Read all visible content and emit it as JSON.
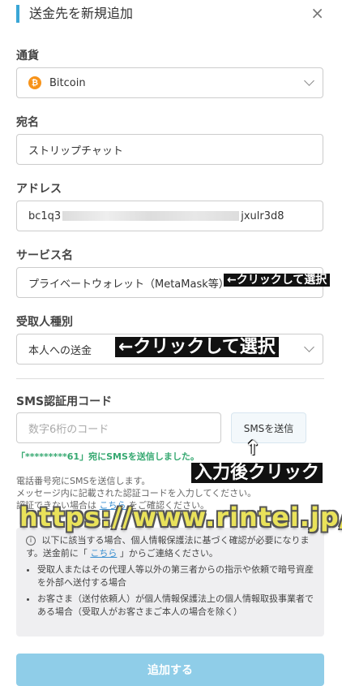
{
  "modal": {
    "title": "送金先を新規追加",
    "close": "×"
  },
  "currency": {
    "label": "通貨",
    "value": "Bitcoin",
    "icon_glyph": "₿"
  },
  "recipient": {
    "label": "宛名",
    "value": "ストリップチャット"
  },
  "address": {
    "label": "アドレス",
    "value_start": "bc1q3",
    "value_end": "jxulr3d8"
  },
  "service": {
    "label": "サービス名",
    "value": "プライベートウォレット（MetaMask等）"
  },
  "recipient_type": {
    "label": "受取人種別",
    "value": "本人への送金"
  },
  "sms": {
    "label": "SMS認証用コード",
    "placeholder": "数字6桁のコード",
    "button": "SMSを送信",
    "sent_message": "「*********61」宛にSMSを送信しました。",
    "info_line1": "電話番号宛にSMSを送信します。",
    "info_line2": "メッセージ内に記載された認証コードを入力してください。",
    "info_line3_pre": "認証できない場合は",
    "info_line3_link": "こちら",
    "info_line3_post": "をご確認ください。"
  },
  "notice": {
    "intro_pre": "以下に該当する場合、個人情報保護法に基づく確認が必要になります。送金前に「",
    "intro_link": "こちら",
    "intro_post": "」からご連絡ください。",
    "items": [
      "受取人またはその代理人等以外の第三者からの指示や依頼で暗号資産を外部へ送付する場合",
      "お客さま（送付依頼人）が個人情報保護法上の個人情報取扱事業者である場合（受取人がお客さまご本人の場合を除く）"
    ]
  },
  "submit": {
    "label": "追加する"
  },
  "annotations": {
    "service_hint": "←クリックして選択",
    "type_hint": "←クリックして選択",
    "input_hint": "入力後クリック",
    "arrow": "↑",
    "watermark": "https://www.rintei.jp/"
  },
  "colors": {
    "accent": "#3aa6d6",
    "success": "#35a870",
    "submit_bg": "#8fcde8",
    "watermark": "#e9e25a"
  }
}
